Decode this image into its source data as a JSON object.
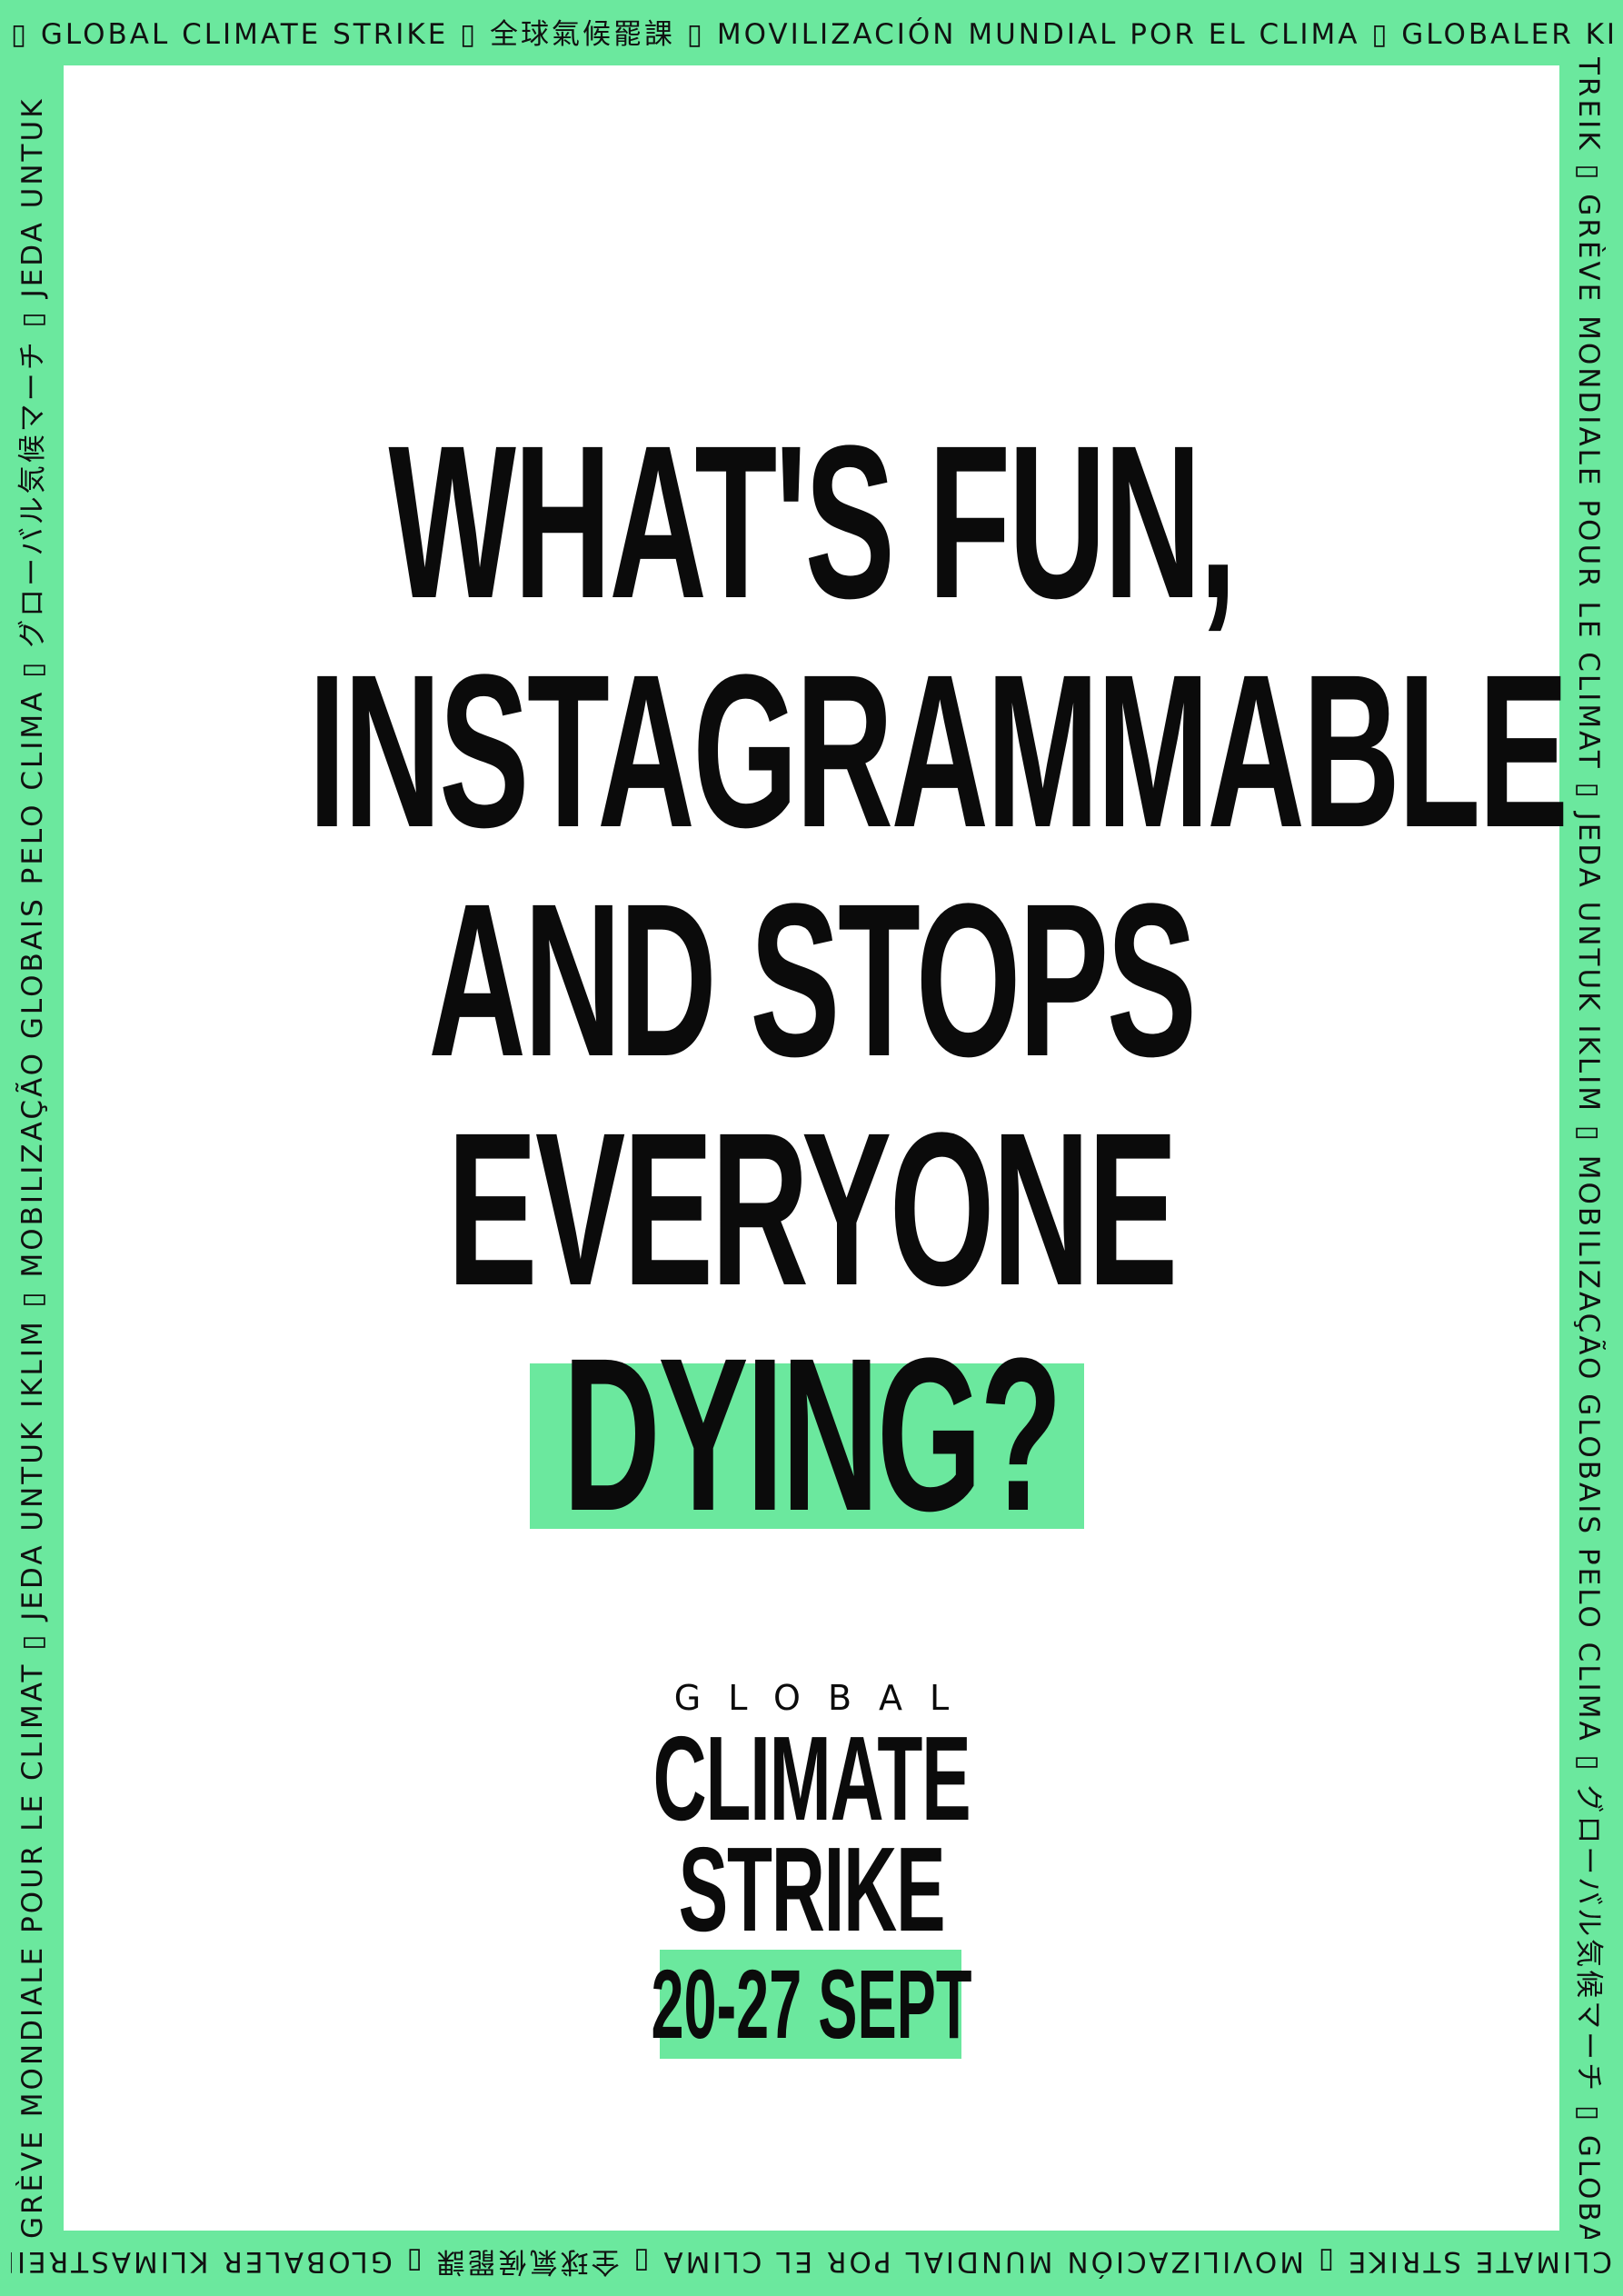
{
  "border": {
    "top_text": "▯ GLOBAL CLIMATE STRIKE ▯ 全球氣候罷課 ▯  MOVILIZACIÓN MUNDIAL POR EL CLIMA ▯ GLOBALER KLIMAS-",
    "right_text": "TREIK ▯ GRÈVE MONDIALE POUR LE CLIMAT ▯ JEDA UNTUK IKLIM ▯ MOBILIZAÇÃO GLOBAIS PELO CLIMA ▯ グローバル気候マーチ ▯ GLOBAL",
    "bottom_text": "CLIMATE STRIKE ▯ MOVILIZACIÓN MUNDIAL POR EL CLIMA ▯ 全球氣候罷課 ▯ GLOBALER KLIMASTREIK ▯",
    "left_text": "GRÈVE MONDIALE POUR LE CLIMAT ▯ JEDA UNTUK IKLIM ▯ MOBILIZAÇÃO GLOBAIS PELO CLIMA ▯ グローバル気候マーチ ▯ JEDA UNTUK",
    "color": "#6be89e"
  },
  "headline": {
    "lines": [
      "WHAT'S FUN,",
      "INSTAGRAMMABLE",
      "AND STOPS",
      "EVERYONE"
    ],
    "highlighted_word": "DYING?",
    "highlight_color": "#6be89e"
  },
  "logo": {
    "global": "GLOBAL",
    "line1": "CLIMATE",
    "line2": "STRIKE"
  },
  "date": {
    "text": "20-27 SEPT",
    "highlight_color": "#6be89e"
  }
}
